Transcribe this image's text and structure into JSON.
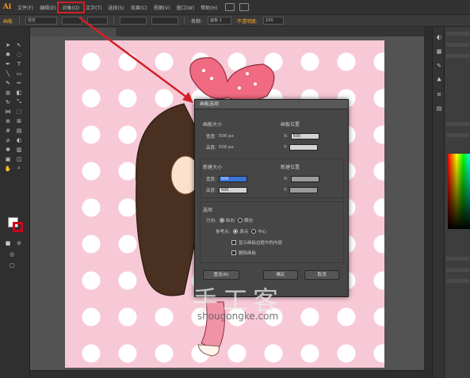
{
  "app": {
    "logo": "Ai"
  },
  "menubar": {
    "items": [
      "文件(F)",
      "编辑(E)",
      "对象(O)",
      "文字(T)",
      "选择(S)",
      "效果(C)",
      "视图(V)",
      "窗口(W)",
      "帮助(H)"
    ],
    "highlighted_index": 2
  },
  "ctrlbar": {
    "label": "画板",
    "preset": "自定 ",
    "fields": [
      "",
      "",
      "",
      ""
    ],
    "name_label": "名称:",
    "name_value": "画板 1",
    "zoom_label": "不透明度:",
    "zoom_value": "100"
  },
  "document": {
    "tab_title": ""
  },
  "dialog": {
    "title": "画板选项",
    "section_size": "画板大小",
    "width_label": "宽度:",
    "width_value": "500 px",
    "height_label": "高度:",
    "height_value": "500 px",
    "section_pos": "画板位置",
    "x_label": "X:",
    "x_value": "500",
    "y_label": "Y:",
    "y_value": "",
    "section_new_size": "新建大小",
    "new_w_label": "宽度:",
    "new_w_value": "500",
    "new_h_label": "高度:",
    "new_h_value": "500",
    "section_new_pos": "新建位置",
    "new_x_label": "X:",
    "new_x_value": "",
    "new_y_label": "Y:",
    "new_y_value": "",
    "section_options": "选项",
    "orientation_label": "方向:",
    "orient_portrait": "纵向",
    "orient_landscape": "横向",
    "ref_label": "参考点:",
    "opt_a": "原点",
    "opt_b": "中心",
    "check_1": "显示画板边框中的内容",
    "check_2": "删除画板",
    "btn_reset": "重设(R)",
    "btn_ok": "确定",
    "btn_cancel": "取消"
  },
  "watermark": {
    "cn": "手工客",
    "url": "shougongke.com"
  },
  "colors": {
    "accent_red": "#d51f26",
    "artboard_pink": "#f7c9d6",
    "ai_orange": "#f7941e"
  }
}
